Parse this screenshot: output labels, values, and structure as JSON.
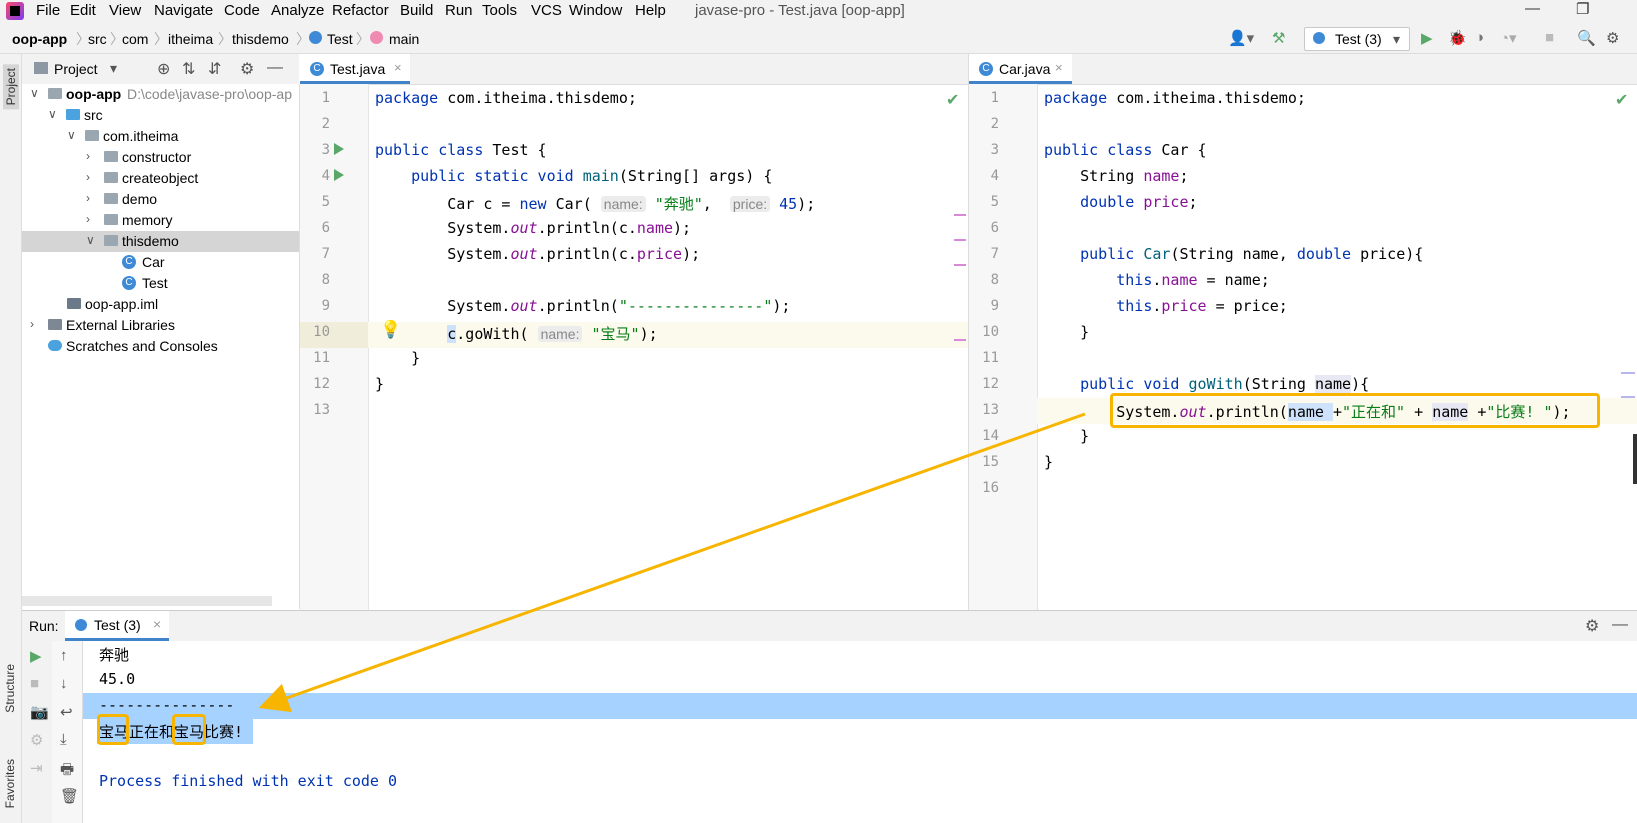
{
  "menubar": {
    "items": [
      "File",
      "Edit",
      "View",
      "Navigate",
      "Code",
      "Analyze",
      "Refactor",
      "Build",
      "Run",
      "Tools",
      "VCS",
      "Window",
      "Help"
    ],
    "mnemonics": [
      "F",
      "E",
      "V",
      "N",
      "C",
      "z",
      "R",
      "B",
      "u",
      "T",
      "S",
      "W",
      "H"
    ],
    "title": "javase-pro - Test.java [oop-app]"
  },
  "breadcrumb": [
    "oop-app",
    "src",
    "com",
    "itheima",
    "thisdemo",
    "Test",
    "main"
  ],
  "toolbar": {
    "run_config": "Test (3)"
  },
  "side_tabs": {
    "project": "Project",
    "structure": "Structure",
    "favorites": "Favorites"
  },
  "project": {
    "header": "Project",
    "tree": [
      {
        "label": "oop-app",
        "extra": "D:\\code\\javase-pro\\oop-ap",
        "depth": 0,
        "arrow": "down",
        "icon": "module"
      },
      {
        "label": "src",
        "depth": 1,
        "arrow": "down",
        "icon": "src-folder"
      },
      {
        "label": "com.itheima",
        "depth": 2,
        "arrow": "down",
        "icon": "package"
      },
      {
        "label": "constructor",
        "depth": 3,
        "arrow": "right",
        "icon": "package"
      },
      {
        "label": "createobject",
        "depth": 3,
        "arrow": "right",
        "icon": "package"
      },
      {
        "label": "demo",
        "depth": 3,
        "arrow": "right",
        "icon": "package"
      },
      {
        "label": "memory",
        "depth": 3,
        "arrow": "right",
        "icon": "package"
      },
      {
        "label": "thisdemo",
        "depth": 3,
        "arrow": "down",
        "icon": "package",
        "selected": true
      },
      {
        "label": "Car",
        "depth": 4,
        "icon": "class"
      },
      {
        "label": "Test",
        "depth": 4,
        "icon": "class"
      },
      {
        "label": "oop-app.iml",
        "depth": 2,
        "icon": "iml"
      },
      {
        "label": "External Libraries",
        "depth": 0,
        "arrow": "right",
        "icon": "libs"
      },
      {
        "label": "Scratches and Consoles",
        "depth": 0,
        "icon": "scratch"
      }
    ]
  },
  "editor_left": {
    "tab": "Test.java",
    "line_numbers": [
      "1",
      "2",
      "3",
      "4",
      "5",
      "6",
      "7",
      "8",
      "9",
      "10",
      "11",
      "12",
      "13"
    ],
    "hints": {
      "name": "name:",
      "price": "price:"
    },
    "strings": {
      "benz": "\"奔驰\"",
      "price": "45",
      "bmw": "\"宝马\"",
      "dashes": "\"---------------\""
    }
  },
  "editor_right": {
    "tab": "Car.java",
    "line_numbers": [
      "1",
      "2",
      "3",
      "4",
      "5",
      "6",
      "7",
      "8",
      "9",
      "10",
      "11",
      "12",
      "13",
      "14",
      "15",
      "16"
    ],
    "strings": {
      "vs": "\"正在和\"",
      "race": "\"比赛! \""
    }
  },
  "run": {
    "label": "Run:",
    "tab": "Test (3)",
    "output": [
      "奔驰",
      "45.0",
      "---------------",
      "宝马正在和宝马比赛!",
      "",
      "Process finished with exit code 0"
    ]
  }
}
